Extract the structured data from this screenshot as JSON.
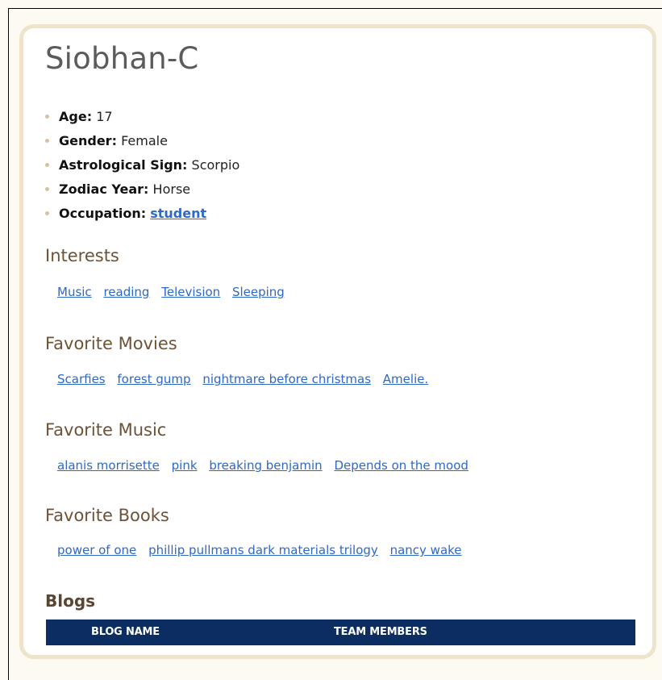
{
  "profile": {
    "name": "Siobhan-C",
    "facts": [
      {
        "label": "Age",
        "value": "17",
        "is_link": false
      },
      {
        "label": "Gender",
        "value": "Female",
        "is_link": false
      },
      {
        "label": "Astrological Sign",
        "value": "Scorpio",
        "is_link": false
      },
      {
        "label": "Zodiac Year",
        "value": "Horse",
        "is_link": false
      },
      {
        "label": "Occupation",
        "value": "student",
        "is_link": true
      }
    ]
  },
  "sections": {
    "interests": {
      "title": "Interests",
      "items": [
        "Music",
        "reading",
        "Television",
        "Sleeping"
      ]
    },
    "movies": {
      "title": "Favorite Movies",
      "items": [
        "Scarfies",
        "forest gump",
        "nightmare before christmas",
        "Amelie."
      ]
    },
    "music": {
      "title": "Favorite Music",
      "items": [
        "alanis morrisette",
        "pink",
        "breaking benjamin",
        "Depends on the mood"
      ]
    },
    "books": {
      "title": "Favorite Books",
      "items": [
        "power of one",
        "phillip pullmans dark materials trilogy",
        "nancy wake"
      ]
    }
  },
  "blogs": {
    "title": "Blogs",
    "columns": [
      "BLOG NAME",
      "TEAM MEMBERS"
    ]
  },
  "colors": {
    "link": "#2e68c7",
    "section_title": "#6e5236",
    "table_header_bg": "#0c2d61",
    "card_border": "#efe3cc",
    "page_bg": "#fdfaf1"
  }
}
